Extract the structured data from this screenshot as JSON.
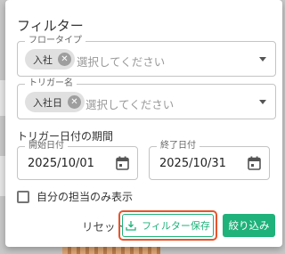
{
  "filter_panel": {
    "title": "フィルター",
    "flow_type": {
      "label": "フロータイプ",
      "chip": "入社",
      "placeholder": "選択してください"
    },
    "trigger_name": {
      "label": "トリガー名",
      "chip": "入社日",
      "placeholder": "選択してください"
    },
    "period": {
      "label": "トリガー日付の期間",
      "start": {
        "label": "開始日付",
        "value": "2025/10/01"
      },
      "end": {
        "label": "終了日付",
        "value": "2025/10/31"
      }
    },
    "own_only": {
      "label": "自分の担当のみ表示",
      "checked": false
    },
    "buttons": {
      "reset": "リセット",
      "save": "フィルター保存",
      "apply": "絞り込み"
    }
  },
  "colors": {
    "accent": "#1fb27a",
    "highlight": "#e8532b"
  },
  "icons": {
    "chip_remove": "close-circle-icon",
    "dropdown": "caret-down-icon",
    "calendar": "calendar-icon",
    "save": "download-icon"
  }
}
